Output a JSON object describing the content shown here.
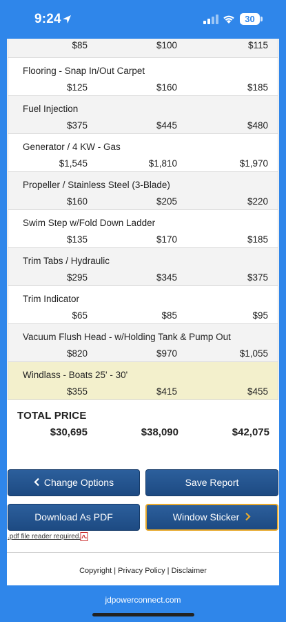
{
  "status_bar": {
    "time": "9:24",
    "battery": "30"
  },
  "rows": [
    {
      "name": "",
      "prices": [
        "$85",
        "$100",
        "$115"
      ],
      "style": "alt"
    },
    {
      "name": "Flooring - Snap In/Out Carpet",
      "prices": [
        "$125",
        "$160",
        "$185"
      ],
      "style": "white"
    },
    {
      "name": "Fuel Injection",
      "prices": [
        "$375",
        "$445",
        "$480"
      ],
      "style": "alt"
    },
    {
      "name": "Generator / 4 KW - Gas",
      "prices": [
        "$1,545",
        "$1,810",
        "$1,970"
      ],
      "style": "white"
    },
    {
      "name": "Propeller / Stainless Steel (3-Blade)",
      "prices": [
        "$160",
        "$205",
        "$220"
      ],
      "style": "alt"
    },
    {
      "name": "Swim Step w/Fold Down Ladder",
      "prices": [
        "$135",
        "$170",
        "$185"
      ],
      "style": "white"
    },
    {
      "name": "Trim Tabs / Hydraulic",
      "prices": [
        "$295",
        "$345",
        "$375"
      ],
      "style": "alt"
    },
    {
      "name": "Trim Indicator",
      "prices": [
        "$65",
        "$85",
        "$95"
      ],
      "style": "white"
    },
    {
      "name": "Vacuum Flush Head - w/Holding Tank & Pump Out",
      "prices": [
        "$820",
        "$970",
        "$1,055"
      ],
      "style": "alt"
    },
    {
      "name": "Windlass - Boats 25' - 30'",
      "prices": [
        "$355",
        "$415",
        "$455"
      ],
      "style": "hl"
    }
  ],
  "total": {
    "label": "TOTAL PRICE",
    "values": [
      "$30,695",
      "$38,090",
      "$42,075"
    ]
  },
  "buttons": {
    "change_options": "Change Options",
    "save_report": "Save Report",
    "download_pdf": "Download As PDF",
    "window_sticker": "Window Sticker"
  },
  "pdf_note": ".pdf file reader required.",
  "footer": {
    "copyright": "Copyright",
    "privacy": "Privacy Policy",
    "disclaimer": "Disclaimer",
    "separator": "|"
  },
  "domain": "jdpowerconnect.com",
  "colors": {
    "brand_blue": "#2f86ea",
    "button_blue": "#1d4a82",
    "highlight_row": "#f3f0cc",
    "sticker_border": "#e8a92c"
  }
}
